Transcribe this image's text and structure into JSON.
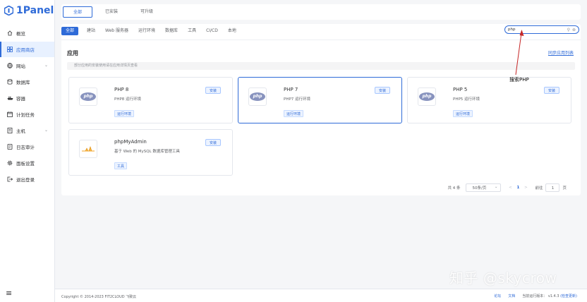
{
  "app": {
    "name": "1Panel"
  },
  "sidebar": {
    "items": [
      {
        "label": "概览",
        "icon": "home-icon"
      },
      {
        "label": "应用商店",
        "icon": "grid-icon",
        "active": true
      },
      {
        "label": "网站",
        "icon": "globe-icon",
        "chevron": "⌄"
      },
      {
        "label": "数据库",
        "icon": "database-icon"
      },
      {
        "label": "容器",
        "icon": "container-icon"
      },
      {
        "label": "计划任务",
        "icon": "calendar-icon"
      },
      {
        "label": "主机",
        "icon": "host-icon",
        "chevron": "⌄"
      },
      {
        "label": "日志审计",
        "icon": "log-icon"
      },
      {
        "label": "面板设置",
        "icon": "gear-icon"
      },
      {
        "label": "退出登录",
        "icon": "logout-icon"
      }
    ],
    "menu_icon": "≡"
  },
  "top_tabs": [
    {
      "label": "全部",
      "active": true
    },
    {
      "label": "已安装"
    },
    {
      "label": "可升级"
    }
  ],
  "filters": [
    {
      "label": "全部",
      "active": true
    },
    {
      "label": "建站"
    },
    {
      "label": "Web 服务器"
    },
    {
      "label": "运行环境"
    },
    {
      "label": "数据库"
    },
    {
      "label": "工具"
    },
    {
      "label": "CI/CD"
    },
    {
      "label": "本地"
    }
  ],
  "search": {
    "value": "php"
  },
  "section": {
    "title": "应用",
    "sync_label": "同步应用列表",
    "notice": "部分应用的安装使用请在应用详情页查看"
  },
  "apps": [
    {
      "name": "PHP 8",
      "desc": "PHP8 运行环境",
      "tag": "运行环境",
      "install": "安装",
      "logo": "php"
    },
    {
      "name": "PHP 7",
      "desc": "PHP7 运行环境",
      "tag": "运行环境",
      "install": "安装",
      "logo": "php"
    },
    {
      "name": "PHP 5",
      "desc": "PHP5 运行环境",
      "tag": "运行环境",
      "install": "安装",
      "logo": "php"
    },
    {
      "name": "phpMyAdmin",
      "desc": "基于 Web 的 MySQL 数据库管理工具",
      "tag": "工具",
      "install": "安装",
      "logo": "pma"
    }
  ],
  "pagination": {
    "total": "共 4 条",
    "page_size": "50条/页",
    "prev": "<",
    "current": "1",
    "next": ">",
    "goto_label": "前往",
    "goto_value": "1",
    "page_suffix": "页"
  },
  "annotation": {
    "text": "搜索PHP",
    "color": "#c62828"
  },
  "watermark": {
    "text": "知乎 @skycrow"
  },
  "footer": {
    "copyright": "Copyright © 2014-2023 FIT2CLOUD 飞致云",
    "forum": "论坛",
    "docs": "文档",
    "version_label": "当前运行版本：",
    "version": "v1.4.3",
    "update": "(检查更新)"
  },
  "colors": {
    "accent": "#2f6bd8",
    "sidebar_active_bg": "#e8f1ff"
  }
}
